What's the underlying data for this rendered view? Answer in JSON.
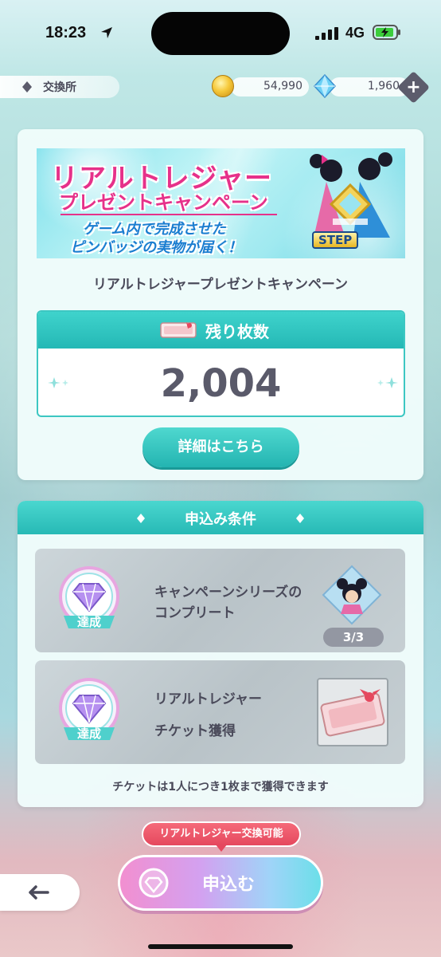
{
  "status_bar": {
    "time": "18:23",
    "network": "4G"
  },
  "header": {
    "location": "交換所",
    "coins": "54,990",
    "gems": "1,960"
  },
  "banner": {
    "title_line1": "リアルトレジャー",
    "title_line2": "プレゼントキャンペーン",
    "subtitle_line1": "ゲーム内で完成させた",
    "subtitle_line2": "ピンバッジの実物が届く！",
    "logo_text": "STEP"
  },
  "campaign": {
    "title": "リアルトレジャープレゼントキャンペーン",
    "remaining_label": "残り枚数",
    "remaining_value": "2,004",
    "details_button": "詳細はこちら"
  },
  "conditions": {
    "header": "申込み条件",
    "items": [
      {
        "line1": "キャンペーンシリーズの",
        "line2": "コンプリート",
        "badge": "達成",
        "progress": "3/3"
      },
      {
        "line1": "リアルトレジャー",
        "line2": "チケット獲得",
        "badge": "達成"
      }
    ],
    "note": "チケットは1人につき1枚まで獲得できます"
  },
  "footer": {
    "exchange_tag": "リアルトレジャー交換可能",
    "apply_button": "申込む"
  },
  "colors": {
    "teal": "#27b9b5",
    "pink_title": "#e6318a",
    "tag_red": "#e5485e"
  }
}
